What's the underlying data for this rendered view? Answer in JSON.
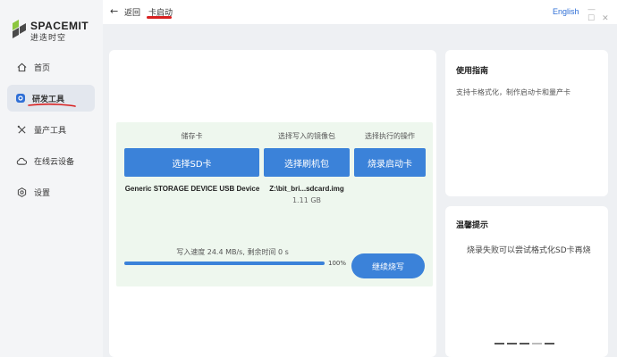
{
  "brand": {
    "name": "SPACEMIT",
    "subtitle": "进迭时空"
  },
  "sidebar": {
    "items": [
      {
        "label": "首页",
        "icon": "home-icon"
      },
      {
        "label": "研发工具",
        "icon": "dev-tools-icon",
        "active": true
      },
      {
        "label": "量产工具",
        "icon": "production-tools-icon"
      },
      {
        "label": "在线云设备",
        "icon": "cloud-device-icon"
      },
      {
        "label": "设置",
        "icon": "gear-icon"
      }
    ]
  },
  "header": {
    "back_label": "返回",
    "current": "卡启动",
    "language": "English"
  },
  "main": {
    "columns": [
      {
        "header": "储存卡",
        "button": "选择SD卡",
        "info": "Generic STORAGE DEVICE USB Device",
        "sub": ""
      },
      {
        "header": "选择写入的镜像包",
        "button": "选择刷机包",
        "info": "Z:\\bit_bri...sdcard.img",
        "sub": "1.11 GB"
      },
      {
        "header": "选择执行的操作",
        "button": "烧录启动卡",
        "info": "",
        "sub": ""
      }
    ],
    "speed_text": "写入速度 24.4 MB/s, 剩余时间 0 s",
    "progress": 100,
    "progress_label": "100%",
    "continue_button": "继续烧写"
  },
  "guide": {
    "title": "使用指南",
    "text": "支持卡格式化，制作启动卡和量产卡"
  },
  "tips": {
    "title": "温馨提示",
    "text": "烧录失败可以尝试格式化SD卡再烧",
    "dot_count": 5,
    "active_dot": 3
  },
  "colors": {
    "accent": "#3b82d9",
    "annotation": "#d82020",
    "panel_bg": "#eef7ee",
    "logo_green": "#8cc63f"
  }
}
